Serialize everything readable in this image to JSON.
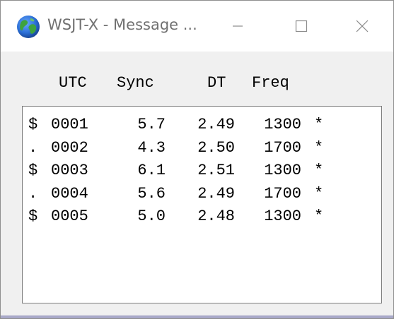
{
  "window": {
    "title": "WSJT-X - Message ...",
    "controls": {
      "minimize": "minimize-icon",
      "maximize": "maximize-icon",
      "close": "close-icon"
    },
    "icon": "globe-icon"
  },
  "columns": {
    "utc": "UTC",
    "sync": "Sync",
    "dt": "DT",
    "freq": "Freq"
  },
  "rows": [
    {
      "marker": "$",
      "utc": "0001",
      "sync": "5.7",
      "dt": "2.49",
      "freq": "1300",
      "flag": "*"
    },
    {
      "marker": ".",
      "utc": "0002",
      "sync": "4.3",
      "dt": "2.50",
      "freq": "1700",
      "flag": "*"
    },
    {
      "marker": "$",
      "utc": "0003",
      "sync": "6.1",
      "dt": "2.51",
      "freq": "1300",
      "flag": "*"
    },
    {
      "marker": ".",
      "utc": "0004",
      "sync": "5.6",
      "dt": "2.49",
      "freq": "1700",
      "flag": "*"
    },
    {
      "marker": "$",
      "utc": "0005",
      "sync": "5.0",
      "dt": "2.48",
      "freq": "1300",
      "flag": "*"
    }
  ],
  "colors": {
    "titlebar": "#ffffff",
    "body": "#f0f0f0",
    "list_background": "#ffffff",
    "title_text": "#707070",
    "globe_ocean": "#2b6fd6",
    "globe_land": "#3ea33e"
  }
}
